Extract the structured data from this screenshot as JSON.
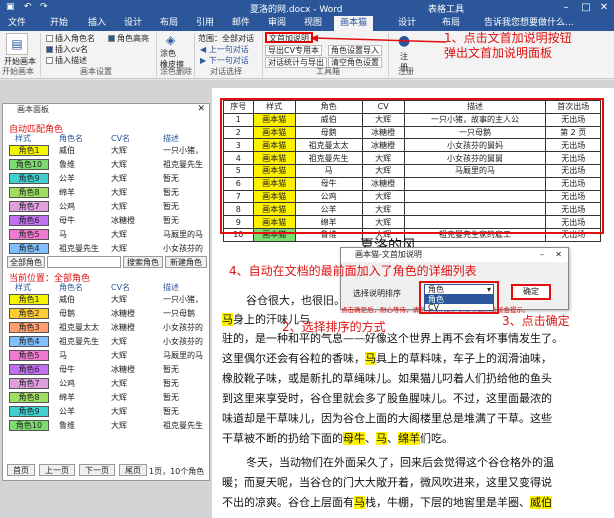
{
  "titlebar": {
    "doc_title": "夏洛的网.docx - Word",
    "context_tab": "表格工具"
  },
  "tabs": [
    "文件",
    "开始",
    "插入",
    "设计",
    "布局",
    "引用",
    "邮件",
    "审阅",
    "视图",
    "画本猫",
    "设计",
    "布局"
  ],
  "tell_me": "告诉我您想要做什么...",
  "ribbon": {
    "open_panel": "开始\n画本",
    "open_panel_label": "开始画本",
    "chk_insert_name": "插入角色名",
    "chk_insert_cv": "插入cv名",
    "chk_insert_desc": "插入描述",
    "chk_highlight": "角色高亮",
    "group_settings": "画本设置",
    "brush": "涂色\n橡皮擦",
    "group_brush": "涂色删除",
    "range_label": "范围：全部对话",
    "prev_dialog": "上一句对话",
    "next_dialog": "下一句对话",
    "group_dialog": "对话选择",
    "btn_doc_desc": "文首加说明",
    "btn_export_cv": "导出CV专用本",
    "btn_export_roles": "角色设置导入",
    "btn_dialog_stats": "对话统计与导出",
    "btn_clear_roles": "清空角色设置",
    "group_tools": "工具箱",
    "register": "注\n册",
    "group_register": "注册"
  },
  "annotations": {
    "a1": "1、点击文首加说明按钮\n弹出文首加说明面板",
    "a2": "2、选择排序的方式",
    "a3": "3、点击确定",
    "a4": "4、自动在文档的最前面加入了角色的详细列表"
  },
  "table": {
    "headers": [
      "序号",
      "样式",
      "角色",
      "CV",
      "描述",
      "首次出场"
    ],
    "rows": [
      [
        "1",
        "画本猫",
        "威伯",
        "大辉",
        "一只小猪，故事的主人公",
        "无出场"
      ],
      [
        "2",
        "画本猫",
        "母鹅",
        "冰糖橙",
        "一只母鹅",
        "第 2 页"
      ],
      [
        "3",
        "画本猫",
        "祖克曼太太",
        "冰糖橙",
        "小女孩芬的舅妈",
        "无出场"
      ],
      [
        "4",
        "画本猫",
        "祖克曼先生",
        "大辉",
        "小女孩芬的舅舅",
        "无出场"
      ],
      [
        "5",
        "画本猫",
        "马",
        "大辉",
        "马厩里的马",
        "无出场"
      ],
      [
        "6",
        "画本猫",
        "母牛",
        "冰糖橙",
        "",
        "无出场"
      ],
      [
        "7",
        "画本猫",
        "公鸡",
        "大辉",
        "",
        "无出场"
      ],
      [
        "8",
        "画本猫",
        "公羊",
        "大辉",
        "",
        "无出场"
      ],
      [
        "9",
        "画本猫",
        "绵羊",
        "大辉",
        "",
        "无出场"
      ],
      [
        "10",
        "画本猫",
        "鲁维",
        "大辉",
        "祖克曼先生家的雇工",
        "无出场"
      ]
    ]
  },
  "doc": {
    "heading": "夏洛的风",
    "line1": "谷仓很大，也很旧。",
    "line2a": "马",
    "line2b": "身上的汗味儿与",
    "line3": "驻的，是一种和平的气息——好像这个世界上再不会有坏事情发生了。",
    "line4a": "这里偶尔还会有谷粒的香味，",
    "line4b": "马",
    "line4c": "具上的草料味，车子上的润滑油味，",
    "line5": "橡胶靴子味，或是新扎的草绳味儿。如果猫儿叼着人们扔给他的鱼头",
    "line6": "到这里来享受时，谷仓里就会多了股鱼腥味儿。不过，这里面最浓的",
    "line7": "味道却是干草味儿，因为谷仓上面的大阁楼里总是堆满了干草。这些",
    "line8a": "干草被不断的扔给下面的",
    "line8b": "母牛",
    "line8c": "、",
    "line8d": "马",
    "line8e": "、",
    "line8f": "绵羊",
    "line8g": "们吃。",
    "line9": "冬天，当动物们在外面呆久了，回来后会觉得这个谷仓格外的温",
    "line10": "暖；而夏天呢，当谷仓的门大大敞开着，微风吹进来，这里又变得说",
    "line11a": "不出的凉爽。谷仓上层面有",
    "line11b": "马",
    "line11c": "栈，牛棚，下层的地窖里是羊圈、",
    "line11d": "威伯"
  },
  "panel": {
    "title": "画本面板",
    "auto_match": "自动匹配角色",
    "current_pos": "当前位置：全部角色",
    "col_style": "样式",
    "col_role": "角色名",
    "col_cv": "CV名",
    "col_desc": "描述",
    "btn_all_roles": "全部角色",
    "btn_search": "搜索角色",
    "btn_new": "新建角色",
    "btn_first": "首页",
    "btn_prev": "上一页",
    "btn_next": "下一页",
    "btn_last": "尾页",
    "page_info": "1页，10个角色",
    "top_rows": [
      {
        "style": "角色1",
        "color": "#f5f500",
        "name": "威伯",
        "cv": "大辉",
        "desc": "一只小猪，"
      },
      {
        "style": "角色10",
        "color": "#7ddc6f",
        "name": "鲁维",
        "cv": "大辉",
        "desc": "祖克曼先生"
      },
      {
        "style": "角色9",
        "color": "#3fd0d0",
        "name": "公羊",
        "cv": "大辉",
        "desc": "暂无"
      },
      {
        "style": "角色8",
        "color": "#9fdf5f",
        "name": "绵羊",
        "cv": "大辉",
        "desc": "暂无"
      },
      {
        "style": "角色7",
        "color": "#e0a0e0",
        "name": "公鸡",
        "cv": "大辉",
        "desc": "暂无"
      },
      {
        "style": "角色6",
        "color": "#c070f0",
        "name": "母牛",
        "cv": "冰糖橙",
        "desc": "暂无"
      },
      {
        "style": "角色5",
        "color": "#f07ad0",
        "name": "马",
        "cv": "大辉",
        "desc": "马厩里的马"
      },
      {
        "style": "角色4",
        "color": "#7fbfff",
        "name": "祖克曼先生",
        "cv": "大辉",
        "desc": "小女孩芬的"
      }
    ],
    "bottom_rows": [
      {
        "style": "角色1",
        "color": "#f5f500",
        "name": "威伯",
        "cv": "大辉",
        "desc": "一只小猪，"
      },
      {
        "style": "角色2",
        "color": "#ffcc33",
        "name": "母鹅",
        "cv": "冰糖橙",
        "desc": "一只母鹅"
      },
      {
        "style": "角色3",
        "color": "#ff9e6e",
        "name": "祖克曼太太",
        "cv": "冰糖橙",
        "desc": "小女孩芬的"
      },
      {
        "style": "角色4",
        "color": "#7fbfff",
        "name": "祖克曼先生",
        "cv": "大辉",
        "desc": "小女孩芬的"
      },
      {
        "style": "角色5",
        "color": "#f07ad0",
        "name": "马",
        "cv": "大辉",
        "desc": "马厩里的马"
      },
      {
        "style": "角色6",
        "color": "#c070f0",
        "name": "母牛",
        "cv": "冰糖橙",
        "desc": "暂无"
      },
      {
        "style": "角色7",
        "color": "#e0a0e0",
        "name": "公鸡",
        "cv": "大辉",
        "desc": "暂无"
      },
      {
        "style": "角色8",
        "color": "#9fdf5f",
        "name": "绵羊",
        "cv": "大辉",
        "desc": "暂无"
      },
      {
        "style": "角色9",
        "color": "#3fd0d0",
        "name": "公羊",
        "cv": "大辉",
        "desc": "暂无"
      },
      {
        "style": "角色10",
        "color": "#7ddc6f",
        "name": "鲁维",
        "cv": "大辉",
        "desc": "祖克曼先生"
      }
    ]
  },
  "dialog": {
    "title": "画本猫-文首加说明",
    "sort_label": "选择说明排序",
    "sort_value": "角色",
    "options": [
      "角色",
      "CV"
    ],
    "ok": "确定",
    "hint": "点击确定后，耐心等待，请勿操作电脑，进度完成后系统会提示。"
  },
  "colors": {
    "word_blue": "#2b579a",
    "annotation_red": "#e01010",
    "highlight_yellow": "#fff200"
  }
}
